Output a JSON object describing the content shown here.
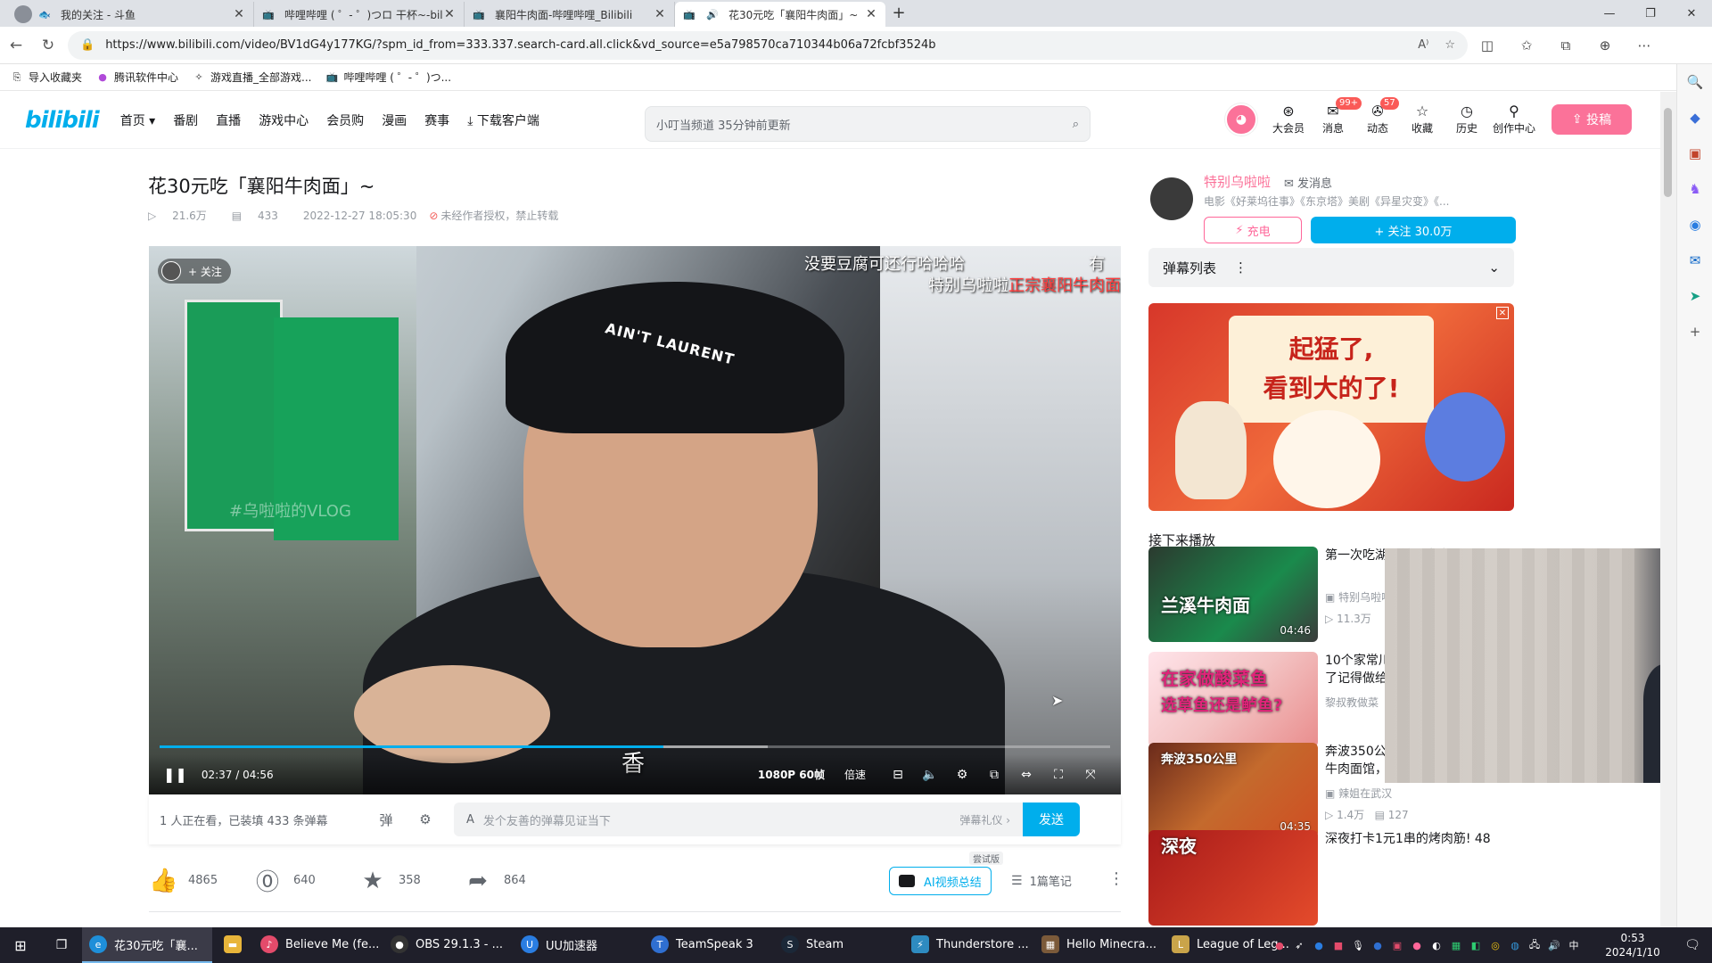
{
  "browser": {
    "tabs": [
      {
        "title": "我的关注 - 斗鱼",
        "icon": "douyu-icon"
      },
      {
        "title": "哔哩哔哩 ( ゜- ゜)つロ 干杯~-bilib",
        "icon": "bilibili-tv-icon"
      },
      {
        "title": "襄阳牛肉面-哔哩哔哩_Bilibili",
        "icon": "bilibili-tv-icon"
      },
      {
        "title": "花30元吃「襄阳牛肉面」~",
        "icon": "bilibili-tv-icon"
      }
    ],
    "url": "https://www.bilibili.com/video/BV1dG4y177KG/?spm_id_from=333.337.search-card.all.click&vd_source=e5a798570ca710344b06a72fcbf3524b",
    "bookmarks": [
      "导入收藏夹",
      "腾讯软件中心",
      "游戏直播_全部游戏...",
      "哔哩哔哩 ( ゜- ゜)つ..."
    ]
  },
  "header": {
    "logo": "bilibili",
    "nav": [
      "首页",
      "番剧",
      "直播",
      "游戏中心",
      "会员购",
      "漫画",
      "赛事",
      "下载客户端"
    ],
    "search_placeholder": "小叮当频道  35分钟前更新",
    "right_items": [
      {
        "label": "大会员",
        "icon": "vip-icon",
        "badge": ""
      },
      {
        "label": "消息",
        "icon": "message-icon",
        "badge": "99+"
      },
      {
        "label": "动态",
        "icon": "dynamic-icon",
        "badge": "57"
      },
      {
        "label": "收藏",
        "icon": "star-icon",
        "badge": ""
      },
      {
        "label": "历史",
        "icon": "history-icon",
        "badge": ""
      },
      {
        "label": "创作中心",
        "icon": "creator-icon",
        "badge": ""
      }
    ],
    "upload": "投稿"
  },
  "video": {
    "title": "花30元吃「襄阳牛肉面」~",
    "views": "21.6万",
    "danmaku_count": "433",
    "date": "2022-12-27 18:05:30",
    "copyright": "未经作者授权，禁止转载"
  },
  "player": {
    "follow_chip": "+ 关注",
    "danmaku": [
      "没要豆腐可还行哈哈哈",
      "有",
      "特别乌啦啦"
    ],
    "danmaku_red": "正宗襄阳牛肉面",
    "watermark": "#乌啦啦的VLOG",
    "cap_text": "AIN'T LAURENT",
    "subtitle": "香",
    "current_time": "02:37",
    "time_sep": "/",
    "total_time": "04:56",
    "progress": 0.53,
    "buffered": 0.64,
    "quality": "1080P 60帧",
    "speed": "倍速"
  },
  "sendbar": {
    "viewers": "1 人正在看，已装填 433 条弹幕",
    "placeholder": "发个友善的弹幕见证当下",
    "etiquette": "弹幕礼仪 ›",
    "send": "发送"
  },
  "actions": {
    "like": "4865",
    "coin": "640",
    "favorite": "358",
    "share": "864",
    "ai_summary": "AI视频总结",
    "ai_tag": "尝试版",
    "notes": "1篇笔记"
  },
  "uploader": {
    "name": "特别乌啦啦",
    "message": "发消息",
    "desc": "电影《好莱坞往事》《东京塔》美剧《异星灾变》《...",
    "charge": "充电",
    "follow": "+ 关注 30.0万"
  },
  "danmaku_list": {
    "label": "弹幕列表"
  },
  "ad": {
    "line1": "起猛了,",
    "line2": "看到大的了!"
  },
  "next_up": {
    "heading": "接下来播放",
    "items": [
      {
        "title": "第一次吃湖北兰溪牛肉面",
        "author": "特别乌啦啦",
        "views": "11.3万",
        "danmaku": "",
        "duration": "04:46",
        "thumb_text": "兰溪牛肉面",
        "thumb_text2": ""
      },
      {
        "title": "10个家常川菜手把手教学，学会了记得做给家人吃!",
        "author": "黎叔教做菜",
        "views": "",
        "danmaku": "",
        "duration": "",
        "thumb_text": "在家做酸菜鱼",
        "thumb_text2": "选草鱼还是鲈鱼?"
      },
      {
        "title": "奔波350公里来吃襄阳排名第一的牛肉面馆，天天排长队...",
        "author": "辣姐在武汉",
        "views": "1.4万",
        "danmaku": "127",
        "duration": "04:35",
        "thumb_text": "奔波350公里",
        "thumb_text2": ""
      },
      {
        "title": "深夜打卡1元1串的烤肉筋! 48",
        "author": "",
        "views": "",
        "danmaku": "",
        "duration": "",
        "thumb_text": "深夜",
        "thumb_text2": ""
      }
    ]
  },
  "taskbar": {
    "apps": [
      {
        "label": "花30元吃「襄...",
        "active": true,
        "color": "#1e8fd9"
      },
      {
        "label": "",
        "active": false,
        "color": "#e8b53a"
      },
      {
        "label": "Believe Me (fe...",
        "active": false,
        "color": "#e34b6b"
      },
      {
        "label": "OBS 29.1.3 - ...",
        "active": false,
        "color": "#333333"
      },
      {
        "label": "UU加速器",
        "active": false,
        "color": "#2a7de1"
      },
      {
        "label": "TeamSpeak 3",
        "active": false,
        "color": "#2f6fd1"
      },
      {
        "label": "Steam",
        "active": false,
        "color": "#1b2838"
      },
      {
        "label": "Thunderstore ...",
        "active": false,
        "color": "#2e8bc0"
      },
      {
        "label": "Hello Minecra...",
        "active": false,
        "color": "#7b5a3a"
      },
      {
        "label": "League of Leg...",
        "active": false,
        "color": "#c9a44a"
      }
    ],
    "ime": "中",
    "time": "0:53",
    "date": "2024/1/10"
  }
}
